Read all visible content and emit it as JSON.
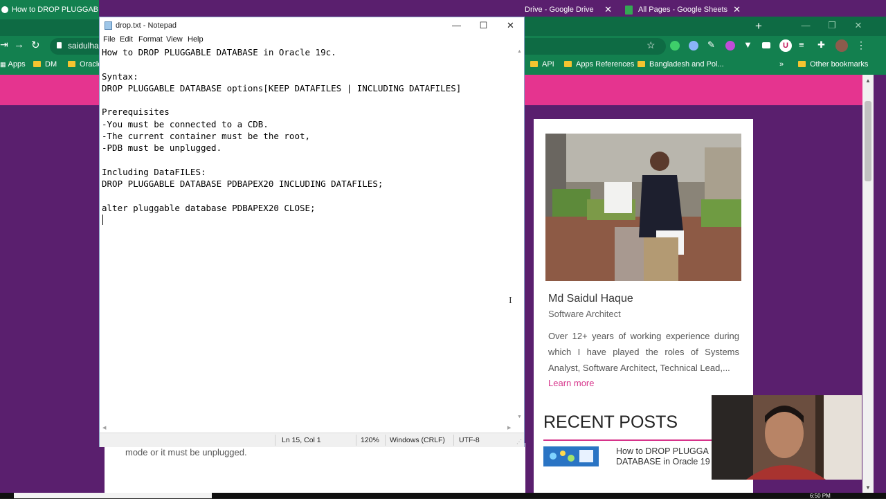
{
  "chrome": {
    "tabs": [
      {
        "label": "How to DROP PLUGGABLE D"
      },
      {
        "label": "Drive - Google Drive"
      },
      {
        "label": "All Pages - Google Sheets"
      }
    ],
    "new_tab": "+",
    "omnibox_text": "saidulha",
    "profile_initial": "U",
    "bookmarks": [
      {
        "label": "Apps"
      },
      {
        "label": "DM"
      },
      {
        "label": "Oracle"
      },
      {
        "label": "API"
      },
      {
        "label": "Apps References"
      },
      {
        "label": "Bangladesh and Pol..."
      },
      {
        "label": "»"
      },
      {
        "label": "Other bookmarks"
      }
    ],
    "colors": {
      "theme": "#13804f",
      "page_bg": "#5a1f6e",
      "accent": "#e5348f"
    }
  },
  "website": {
    "main_snippet": "mode or it must be unplugged.",
    "author": {
      "name": "Md Saidul Haque",
      "role": "Software Architect",
      "bio": "Over 12+ years of working experience during which I have played the roles of Systems Analyst, Software Architect, Technical Lead,...",
      "learn_more": "Learn more"
    },
    "recent_posts_title": "RECENT POSTS",
    "recent_posts": [
      {
        "title": "How to DROP PLUGGA DATABASE in Oracle 19"
      }
    ]
  },
  "notepad": {
    "title": "drop.txt - Notepad",
    "menu": [
      "File",
      "Edit",
      "Format",
      "View",
      "Help"
    ],
    "content": "How to DROP PLUGGABLE DATABASE in Oracle 19c.\n\nSyntax:\nDROP PLUGGABLE DATABASE options[KEEP DATAFILES | INCLUDING DATAFILES]\n\nPrerequisites\n-You must be connected to a CDB.\n-The current container must be the root,\n-PDB must be unplugged.\n\nIncluding DataFILES:\nDROP PLUGGABLE DATABASE PDBAPEX20 INCLUDING DATAFILES;\n\nalter pluggable database PDBAPEX20 CLOSE;\n",
    "status": {
      "position": "Ln 15, Col 1",
      "zoom": "120%",
      "line_endings": "Windows (CRLF)",
      "encoding": "UTF-8"
    }
  },
  "taskbar": {
    "clock": "6:50 PM"
  }
}
